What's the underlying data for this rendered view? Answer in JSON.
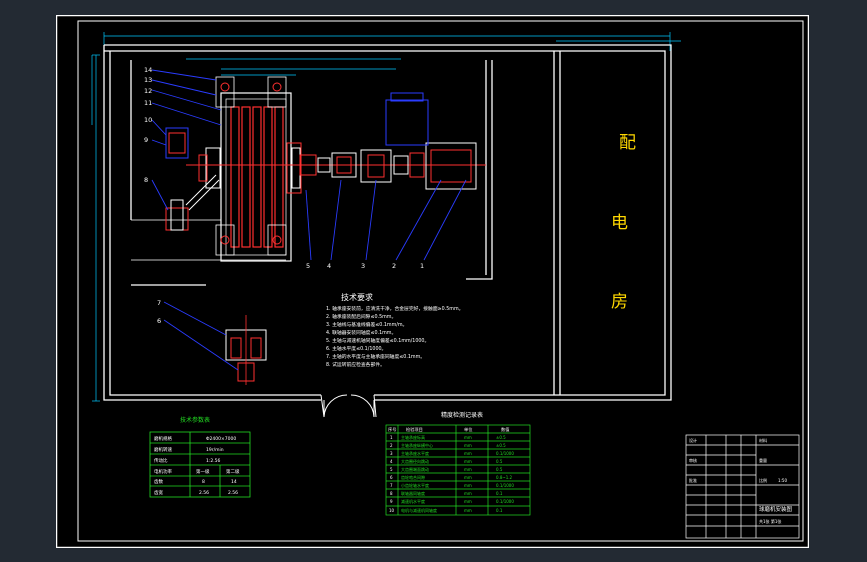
{
  "room": {
    "chars": [
      "配",
      "电",
      "房"
    ]
  },
  "tech": {
    "title": "技术要求",
    "lines": [
      "1. 轴承座安装前，应清洗干净，合金层完好，接触面≥0.5mm。",
      "2. 轴承座装配后间隙≤0.5mm。",
      "3. 主轴线与基准线偏差≤0.1mm/m。",
      "4. 联轴器安装同轴度≤0.1mm。",
      "5. 主轴与减速机轴同轴度偏差≤0.1mm/1000。",
      "6. 主轴水平度≤0.1/1000。",
      "7. 主轴的水平度与主轴承座同轴度≤0.1mm。",
      "8. 试运转前应检查各部件。"
    ]
  },
  "leader_labels": {
    "left": [
      "14",
      "13",
      "12",
      "11",
      "10",
      "9",
      "8"
    ],
    "bottom": [
      "5",
      "4",
      "3",
      "2",
      "1"
    ],
    "lower": [
      "7",
      "6"
    ]
  },
  "params_table": {
    "title": "技术参数表",
    "rows": [
      [
        "磨机规格",
        "Φ2400×7000"
      ],
      [
        "磨机转速",
        "19r/min"
      ],
      [
        "传动比",
        "1:2.56"
      ],
      [
        "电机功率",
        "第一级",
        "第二级"
      ],
      [
        "齿数",
        "8",
        "14"
      ],
      [
        "齿宽",
        "2.56",
        "2.56"
      ]
    ]
  },
  "spec_table": {
    "title": "精度检测记录表",
    "header": [
      "序号",
      "检验项目",
      "单位",
      "数值"
    ],
    "rows": [
      [
        "1",
        "主轴承座标高",
        "mm",
        "±0.5"
      ],
      [
        "2",
        "主轴承座纵横中心",
        "mm",
        "±0.5"
      ],
      [
        "3",
        "主轴承座水平度",
        "mm",
        "0.1/1000"
      ],
      [
        "4",
        "大齿圈径向跳动",
        "mm",
        "0.5"
      ],
      [
        "5",
        "大齿圈端面跳动",
        "mm",
        "0.5"
      ],
      [
        "6",
        "齿轮啮合间隙",
        "mm",
        "0.8~1.2"
      ],
      [
        "7",
        "小齿轮轴水平度",
        "mm",
        "0.1/1000"
      ],
      [
        "8",
        "联轴器同轴度",
        "mm",
        "0.1"
      ],
      [
        "9",
        "减速机水平度",
        "mm",
        "0.1/1000"
      ],
      [
        "10",
        "电机与减速机同轴度",
        "mm",
        "0.1"
      ]
    ]
  },
  "title_block": {
    "drawing_name": "球磨机安装图",
    "scale_label": "比例",
    "scale_value": "1:50",
    "sheet": "共1张 第1张",
    "designer": "设计",
    "checker": "审核",
    "approver": "批准",
    "material": "材料",
    "weight": "重量"
  }
}
